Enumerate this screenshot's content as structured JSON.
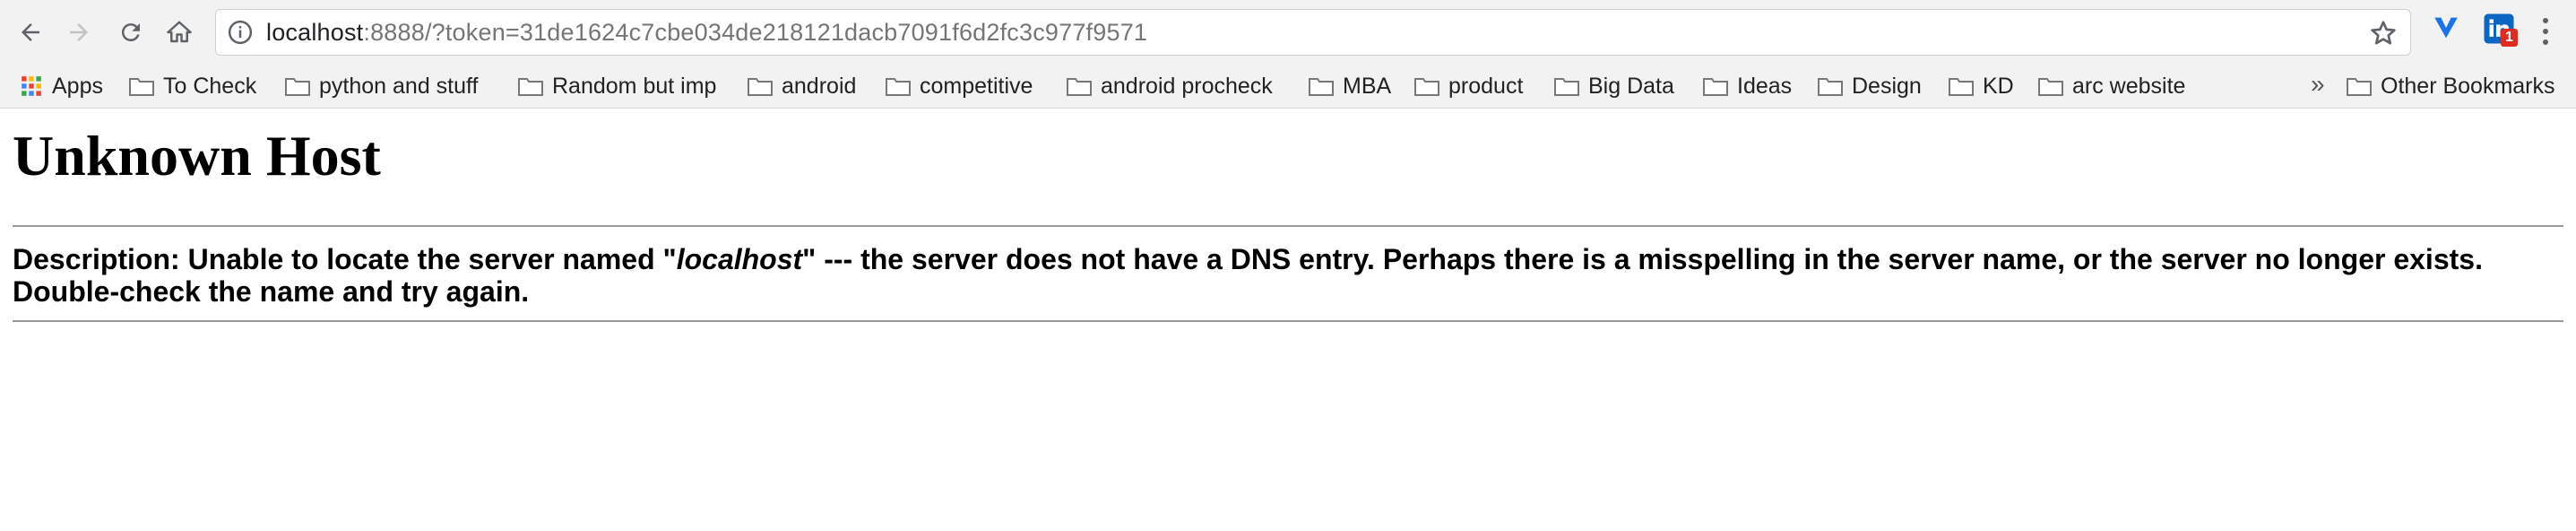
{
  "browser": {
    "address": {
      "host": "localhost",
      "rest": ":8888/?token=31de1624c7cbe034de218121dacb7091f6d2fc3c977f9571"
    },
    "extension_badge": "1"
  },
  "bookmarks": [
    {
      "label": "Apps",
      "icon": "apps-grid-icon"
    },
    {
      "label": "To Check",
      "icon": "folder-icon"
    },
    {
      "label": "python and stuff",
      "icon": "folder-icon"
    },
    {
      "label": "Random but imp",
      "icon": "folder-icon"
    },
    {
      "label": "android",
      "icon": "folder-icon"
    },
    {
      "label": "competitive",
      "icon": "folder-icon"
    },
    {
      "label": "android procheck",
      "icon": "folder-icon"
    },
    {
      "label": "MBA",
      "icon": "folder-icon"
    },
    {
      "label": "product",
      "icon": "folder-icon"
    },
    {
      "label": "Big Data",
      "icon": "folder-icon"
    },
    {
      "label": "Ideas",
      "icon": "folder-icon"
    },
    {
      "label": "Design",
      "icon": "folder-icon"
    },
    {
      "label": "KD",
      "icon": "folder-icon"
    },
    {
      "label": "arc website",
      "icon": "folder-icon"
    }
  ],
  "overflow_chevron": "»",
  "other_bookmarks": "Other Bookmarks",
  "page": {
    "title": "Unknown Host",
    "description_prefix": "Description: Unable to locate the server named \"",
    "description_host": "localhost",
    "description_suffix": "\" --- the server does not have a DNS entry. Perhaps there is a misspelling in the server name, or the server no longer exists.",
    "description_line2": "Double-check the name and try again."
  }
}
